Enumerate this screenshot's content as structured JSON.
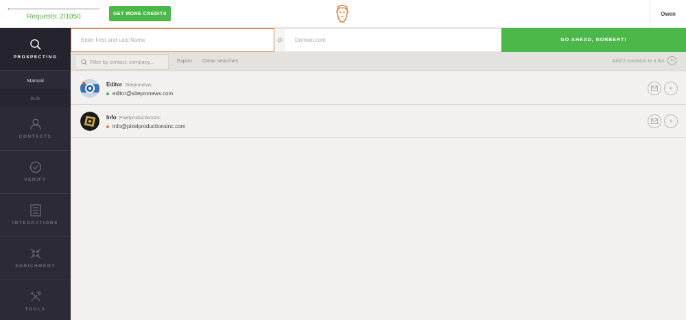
{
  "topbar": {
    "requests_text": "Requests: 2/1050",
    "requests_progress": 0.0019,
    "credits_button": "GET MORE CREDITS",
    "user_name": "Owen"
  },
  "sidebar": {
    "items": [
      {
        "label": "PROSPECTING",
        "icon": "search-icon",
        "active": true
      },
      {
        "label": "CONTACTS",
        "icon": "user-icon",
        "active": false
      },
      {
        "label": "VERIFY",
        "icon": "check-circle-icon",
        "active": false
      },
      {
        "label": "INTEGRATIONS",
        "icon": "integrations-icon",
        "active": false
      },
      {
        "label": "ENRICHMENT",
        "icon": "enrichment-icon",
        "active": false
      },
      {
        "label": "TOOLS",
        "icon": "tools-icon",
        "active": false
      }
    ],
    "subitems": [
      {
        "label": "Manual"
      },
      {
        "label": "Bulk"
      }
    ]
  },
  "search": {
    "name_placeholder": "Enter First and Last Name",
    "at_symbol": "@",
    "domain_placeholder": "Domain.com",
    "go_button": "GO AHEAD, NORBERT!"
  },
  "toolbar": {
    "filter_placeholder": "Filter by contact, company...",
    "export_label": "Export",
    "clean_label": "Clean searches",
    "add_list_label": "Add 2 contacts to a list",
    "add_icon_glyph": "+"
  },
  "contacts": [
    {
      "name": "Editor",
      "company": "Sitepronews",
      "email": "editor@sitepronews.com",
      "status_color": "#4db84a"
    },
    {
      "name": "Info",
      "company": "Pixelproductionsinc",
      "email": "info@pixelproductionsinc.com",
      "status_color": "#e07a3f"
    }
  ],
  "colors": {
    "accent_green": "#4db84a",
    "accent_orange": "#e07a3f",
    "sidebar_bg": "#2b2a36"
  }
}
